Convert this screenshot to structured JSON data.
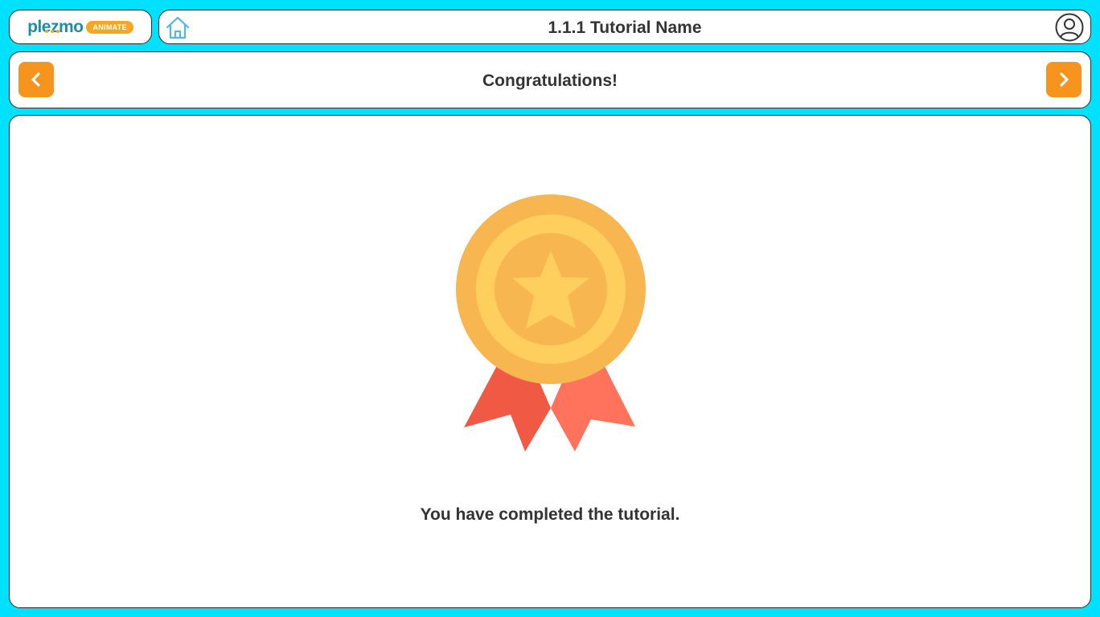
{
  "header": {
    "logo_text": "plezmo",
    "logo_badge": "ANIMATE",
    "tutorial_title": "1.1.1 Tutorial Name",
    "home_icon": "home-icon",
    "user_icon": "user-circle-icon"
  },
  "nav": {
    "prev_icon": "chevron-left-icon",
    "next_icon": "chevron-right-icon",
    "page_title": "Congratulations!"
  },
  "content": {
    "medal_icon": "medal-icon",
    "message": "You have completed the tutorial."
  },
  "colors": {
    "background": "#00e1ff",
    "accent": "#f7941d",
    "logo_blue": "#1d8ea8",
    "medal_gold": "#f7b64f",
    "medal_light": "#fecf5c",
    "ribbon_dark": "#f05a45",
    "ribbon_light": "#ff735c"
  }
}
